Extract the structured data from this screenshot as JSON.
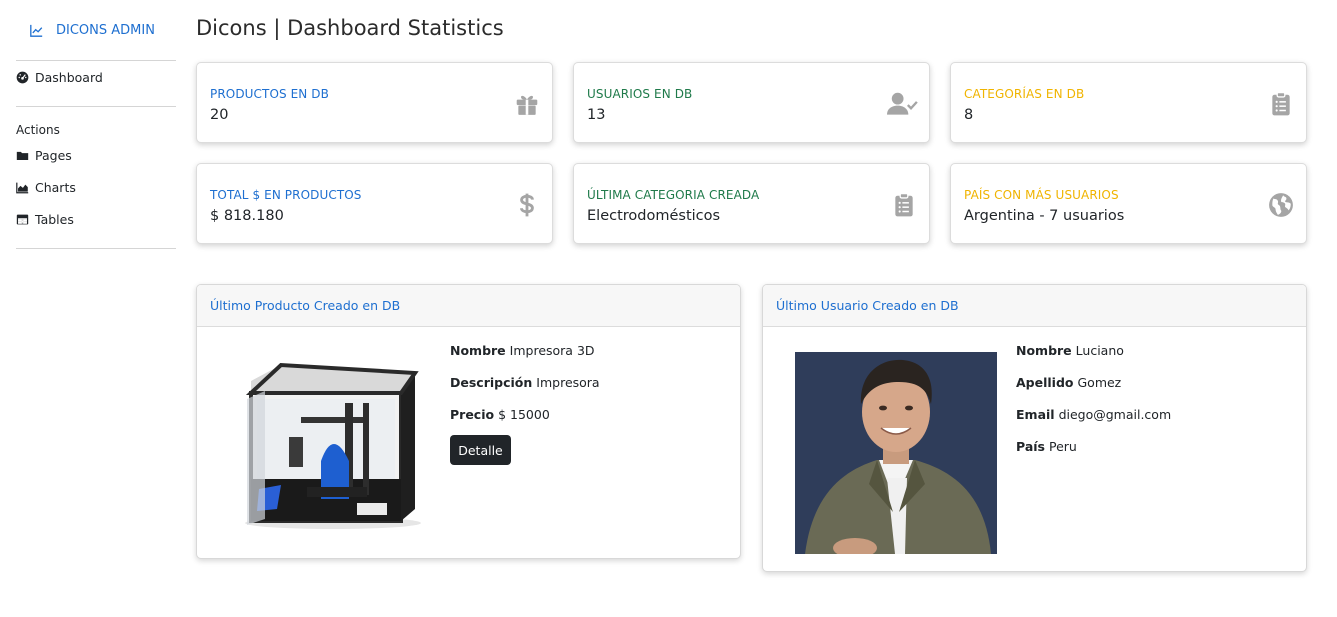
{
  "sidebar": {
    "brand": "DICONS ADMIN",
    "dashboard": "Dashboard",
    "actions_heading": "Actions",
    "items": [
      {
        "label": "Pages",
        "icon": "folder-icon"
      },
      {
        "label": "Charts",
        "icon": "area-chart-icon"
      },
      {
        "label": "Tables",
        "icon": "table-icon"
      }
    ]
  },
  "page_title": "Dicons | Dashboard Statistics",
  "stats": [
    {
      "label": "PRODUCTOS EN DB",
      "value": "20",
      "icon": "gift-icon",
      "color": "#1e6fd0"
    },
    {
      "label": "USUARIOS EN DB",
      "value": "13",
      "icon": "user-check-icon",
      "color": "#1f7a4a"
    },
    {
      "label": "CATEGORÍAS EN DB",
      "value": "8",
      "icon": "clipboard-list-icon",
      "color": "#f0b400"
    },
    {
      "label": "TOTAL $ EN PRODUCTOS",
      "value": "$ 818.180",
      "icon": "dollar-icon",
      "color": "#1e6fd0"
    },
    {
      "label": "ÚLTIMA CATEGORIA CREADA",
      "value": "Electrodomésticos",
      "icon": "clipboard-list-icon",
      "color": "#1f7a4a"
    },
    {
      "label": "PAÍS CON MÁS USUARIOS",
      "value": "Argentina - 7 usuarios",
      "icon": "globe-icon",
      "color": "#f0b400"
    }
  ],
  "product_card": {
    "title": "Último Producto Creado en DB",
    "nombre_label": "Nombre",
    "nombre": "Impresora 3D",
    "descripcion_label": "Descripción",
    "descripcion": "Impresora",
    "precio_label": "Precio",
    "precio": "$ 15000",
    "button": "Detalle"
  },
  "user_card": {
    "title": "Último Usuario Creado en DB",
    "nombre_label": "Nombre",
    "nombre": "Luciano",
    "apellido_label": "Apellido",
    "apellido": "Gomez",
    "email_label": "Email",
    "email": "diego@gmail.com",
    "pais_label": "País",
    "pais": "Peru"
  }
}
